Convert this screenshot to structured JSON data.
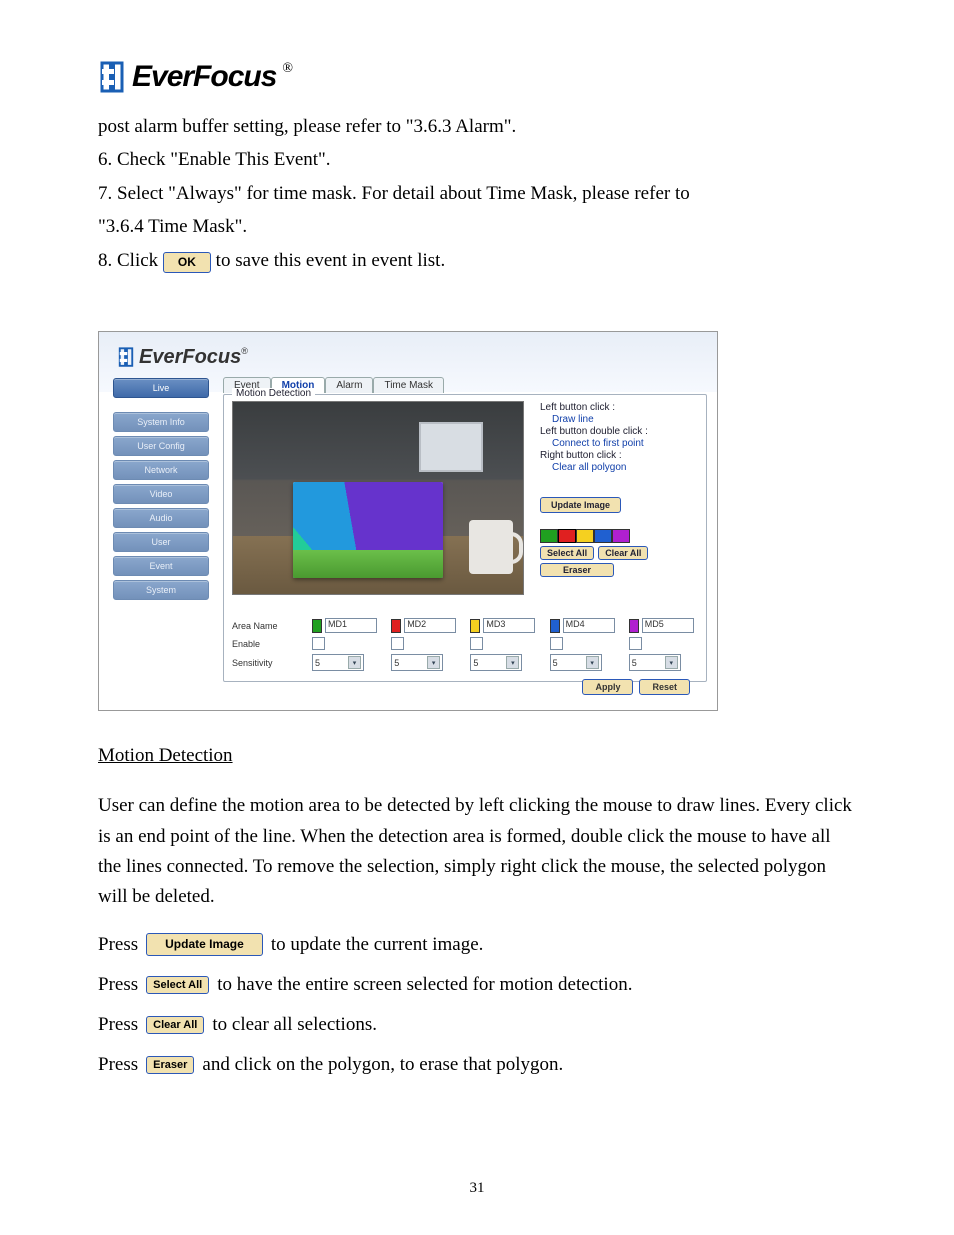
{
  "logo": {
    "brand": "EverFocus",
    "reg": "®"
  },
  "intro_lines": [
    "post alarm buffer setting, please refer to \"3.6.3 Alarm\".",
    "6. Check \"Enable This Event\".",
    "7. Select \"Always\" for time mask. For detail about Time Mask, please refer to",
    "\"3.6.4 Time Mask\"."
  ],
  "step8": {
    "before": "8. Click ",
    "btn": "OK",
    "after": " to save this event in event list."
  },
  "shot": {
    "brand": "EverFocus",
    "reg": "®",
    "sidebar": {
      "live": "Live",
      "items": [
        "System Info",
        "User Config",
        "Network",
        "Video",
        "Audio",
        "User",
        "Event",
        "System"
      ]
    },
    "tabs": [
      "Event",
      "Motion",
      "Alarm",
      "Time Mask"
    ],
    "active_tab": 1,
    "legend": "Motion Detection",
    "hints": {
      "h1": "Left button click :",
      "s1": "Draw line",
      "h2": "Left button double click :",
      "s2": "Connect to first point",
      "h3": "Right button click :",
      "s3": "Clear all polygon"
    },
    "update_btn": "Update Image",
    "select_all": "Select All",
    "clear_all": "Clear All",
    "eraser": "Eraser",
    "colors": [
      "#20a020",
      "#e02020",
      "#f5d020",
      "#2060d0",
      "#b020d0"
    ],
    "row_labels": {
      "area": "Area Name",
      "enable": "Enable",
      "sens": "Sensitivity"
    },
    "areas": [
      {
        "name": "MD1",
        "color": "#20a020",
        "sens": "5"
      },
      {
        "name": "MD2",
        "color": "#e02020",
        "sens": "5"
      },
      {
        "name": "MD3",
        "color": "#f5d020",
        "sens": "5"
      },
      {
        "name": "MD4",
        "color": "#2060d0",
        "sens": "5"
      },
      {
        "name": "MD5",
        "color": "#b020d0",
        "sens": "5"
      }
    ],
    "apply": "Apply",
    "reset": "Reset"
  },
  "section_head": "Motion Detection",
  "para": "User can define the motion area to be detected by left clicking the mouse to draw lines. Every click is an end point of the line. When the detection area is formed, double click the mouse to have all the lines connected. To remove the selection, simply right click the mouse, the selected polygon will be deleted.",
  "press_rows": [
    {
      "before": "Press",
      "btn": "Update Image",
      "after": "to update the current image.",
      "size": "lg"
    },
    {
      "before": "Press",
      "btn": "Select All",
      "after": "to have the entire screen selected for motion detection.",
      "size": "tight"
    },
    {
      "before": "Press",
      "btn": "Clear All",
      "after": "to clear all selections.",
      "size": "tight"
    },
    {
      "before": "Press",
      "btn": "Eraser",
      "after": "and click on the polygon, to erase that polygon.",
      "size": "tight"
    }
  ],
  "page_num": "31"
}
